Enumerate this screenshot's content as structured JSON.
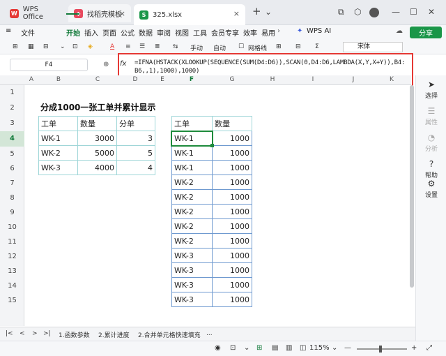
{
  "titlebar": {
    "tabs": [
      {
        "label": "WPS Office"
      },
      {
        "label": "找稻壳模板"
      },
      {
        "label": "325.xlsx"
      }
    ],
    "new_tab": "+",
    "menu_chevron": "⌄"
  },
  "menu": {
    "file": "文件",
    "items": [
      "开始",
      "插入",
      "页面",
      "公式",
      "数据",
      "审阅",
      "视图",
      "工具",
      "会员专享",
      "效率",
      "易用"
    ],
    "wps_ai": "WPS AI",
    "share": "分享"
  },
  "toolbar": {
    "manual": "手动",
    "auto": "自动",
    "gridlines": "网格线",
    "font": "宋体"
  },
  "formula_bar": {
    "name_box": "F4",
    "fx": "fx",
    "formula": "=IFNA(HSTACK(XLOOKUP(SEQUENCE(SUM(D4:D6)),SCAN(0,D4:D6,LAMBDA(X,Y,X+Y)),B4:B6,,1),1000),1000)"
  },
  "sheet": {
    "columns": [
      "A",
      "B",
      "C",
      "D",
      "E",
      "F",
      "G",
      "H",
      "I",
      "J",
      "K"
    ],
    "rows": [
      "1",
      "2",
      "3",
      "4",
      "5",
      "6",
      "7",
      "8",
      "9",
      "10",
      "11",
      "12",
      "13",
      "14",
      "15"
    ],
    "title": "分成1000一张工单并累计显示",
    "table1": {
      "headers": [
        "工单",
        "数量",
        "分单"
      ],
      "rows": [
        [
          "WK-1",
          "3000",
          "3"
        ],
        [
          "WK-2",
          "5000",
          "5"
        ],
        [
          "WK-3",
          "4000",
          "4"
        ]
      ]
    },
    "table2": {
      "headers": [
        "工单",
        "数量"
      ],
      "rows": [
        [
          "WK-1",
          "1000"
        ],
        [
          "WK-1",
          "1000"
        ],
        [
          "WK-1",
          "1000"
        ],
        [
          "WK-2",
          "1000"
        ],
        [
          "WK-2",
          "1000"
        ],
        [
          "WK-2",
          "1000"
        ],
        [
          "WK-2",
          "1000"
        ],
        [
          "WK-2",
          "1000"
        ],
        [
          "WK-3",
          "1000"
        ],
        [
          "WK-3",
          "1000"
        ],
        [
          "WK-3",
          "1000"
        ],
        [
          "WK-3",
          "1000"
        ]
      ]
    }
  },
  "right_panel": [
    {
      "label": "选择",
      "icon": "cursor-icon"
    },
    {
      "label": "属性",
      "icon": "properties-icon"
    },
    {
      "label": "分析",
      "icon": "analysis-icon"
    },
    {
      "label": "帮助",
      "icon": "help-icon"
    },
    {
      "label": "设置",
      "icon": "settings-icon"
    }
  ],
  "sheet_tabs": [
    "1.函数参数",
    "2.累计进度",
    "2.合并单元格快速填充",
    "..."
  ],
  "status": {
    "zoom": "115%"
  },
  "colors": {
    "accent_green": "#127a3a",
    "highlight_red": "#e53935",
    "table_border_cyan": "#9fd6d8",
    "table_border_blue": "#6f9ad0"
  }
}
